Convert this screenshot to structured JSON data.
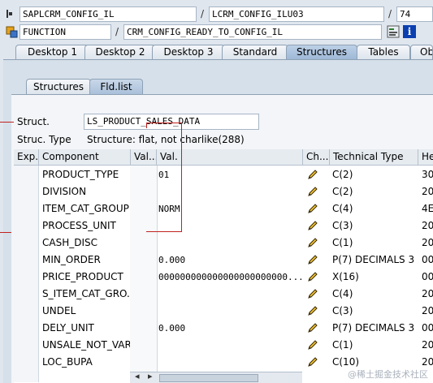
{
  "toolbar": {
    "program": "SAPLCRM_CONFIG_IL",
    "include": "LCRM_CONFIG_ILU03",
    "line": "74",
    "object_type": "FUNCTION",
    "object_name": "CRM_CONFIG_READY_TO_CONFIG_IL",
    "separator": "/"
  },
  "tabs": [
    {
      "label": "Desktop 1"
    },
    {
      "label": "Desktop 2"
    },
    {
      "label": "Desktop 3"
    },
    {
      "label": "Standard"
    },
    {
      "label": "Structures",
      "active": true
    },
    {
      "label": "Tables"
    },
    {
      "label": "Obj"
    }
  ],
  "subtabs": [
    {
      "label": "Structures"
    },
    {
      "label": "Fld.list",
      "active": true
    }
  ],
  "struct": {
    "label": "Struct.",
    "value": "LS_PRODUCT_SALES_DATA",
    "type_label": "Struc. Type",
    "type_value": "Structure: flat, not charlike(288)"
  },
  "columns": {
    "exp": "Exp.",
    "component": "Component",
    "val_short": "Val...",
    "val": "Val.",
    "ch": "Ch...",
    "tech": "Technical Type",
    "he": "He"
  },
  "rows": [
    {
      "component": "PRODUCT_TYPE",
      "value": "01",
      "tech": "C(2)",
      "he": "30"
    },
    {
      "component": "DIVISION",
      "value": "",
      "tech": "C(2)",
      "he": "20"
    },
    {
      "component": "ITEM_CAT_GROUP",
      "value": "NORM",
      "tech": "C(4)",
      "he": "4E"
    },
    {
      "component": "PROCESS_UNIT",
      "value": "",
      "tech": "C(3)",
      "he": "20"
    },
    {
      "component": "CASH_DISC",
      "value": "",
      "tech": "C(1)",
      "he": "20"
    },
    {
      "component": "MIN_ORDER",
      "value": "0.000",
      "tech": "P(7) DECIMALS 3",
      "he": "00"
    },
    {
      "component": "PRICE_PRODUCT",
      "value": "000000000000000000000000...",
      "tech": "X(16)",
      "he": "00"
    },
    {
      "component": "S_ITEM_CAT_GRO...",
      "value": "",
      "tech": "C(4)",
      "he": "20"
    },
    {
      "component": "UNDEL",
      "value": "",
      "tech": "C(3)",
      "he": "20"
    },
    {
      "component": "DELY_UNIT",
      "value": "0.000",
      "tech": "P(7) DECIMALS 3",
      "he": "00"
    },
    {
      "component": "UNSALE_NOT_VAR",
      "value": "",
      "tech": "C(1)",
      "he": "20"
    },
    {
      "component": "LOC_BUPA",
      "value": "",
      "tech": "C(10)",
      "he": "20"
    }
  ],
  "scroll": {
    "left_arrow": "◂",
    "right_arrow": "▸"
  },
  "watermark": "@稀土掘金技术社区",
  "colors": {
    "accent_red": "#c0221e",
    "info_blue": "#0b3fb0"
  }
}
